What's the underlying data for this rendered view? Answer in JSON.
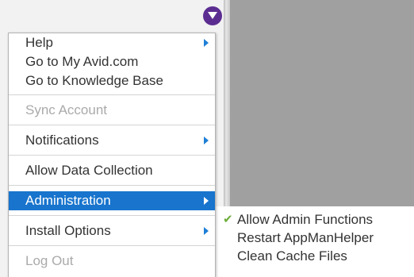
{
  "colors": {
    "accent": "#1874cd",
    "trigger": "#5c2d91",
    "check": "#6cad3a",
    "arrow": "#1e7fd6"
  },
  "trigger": {
    "icon": "chevron-down-icon"
  },
  "menu": {
    "help": "Help",
    "go_my_avid": "Go to My Avid.com",
    "go_kb": "Go to Knowledge Base",
    "sync_account": "Sync Account",
    "notifications": "Notifications",
    "allow_data": "Allow Data Collection",
    "administration": "Administration",
    "install_options": "Install Options",
    "log_out": "Log Out"
  },
  "submenu": {
    "allow_admin": "Allow Admin Functions",
    "allow_admin_checked": true,
    "restart_helper": "Restart AppManHelper",
    "clean_cache": "Clean Cache Files"
  }
}
